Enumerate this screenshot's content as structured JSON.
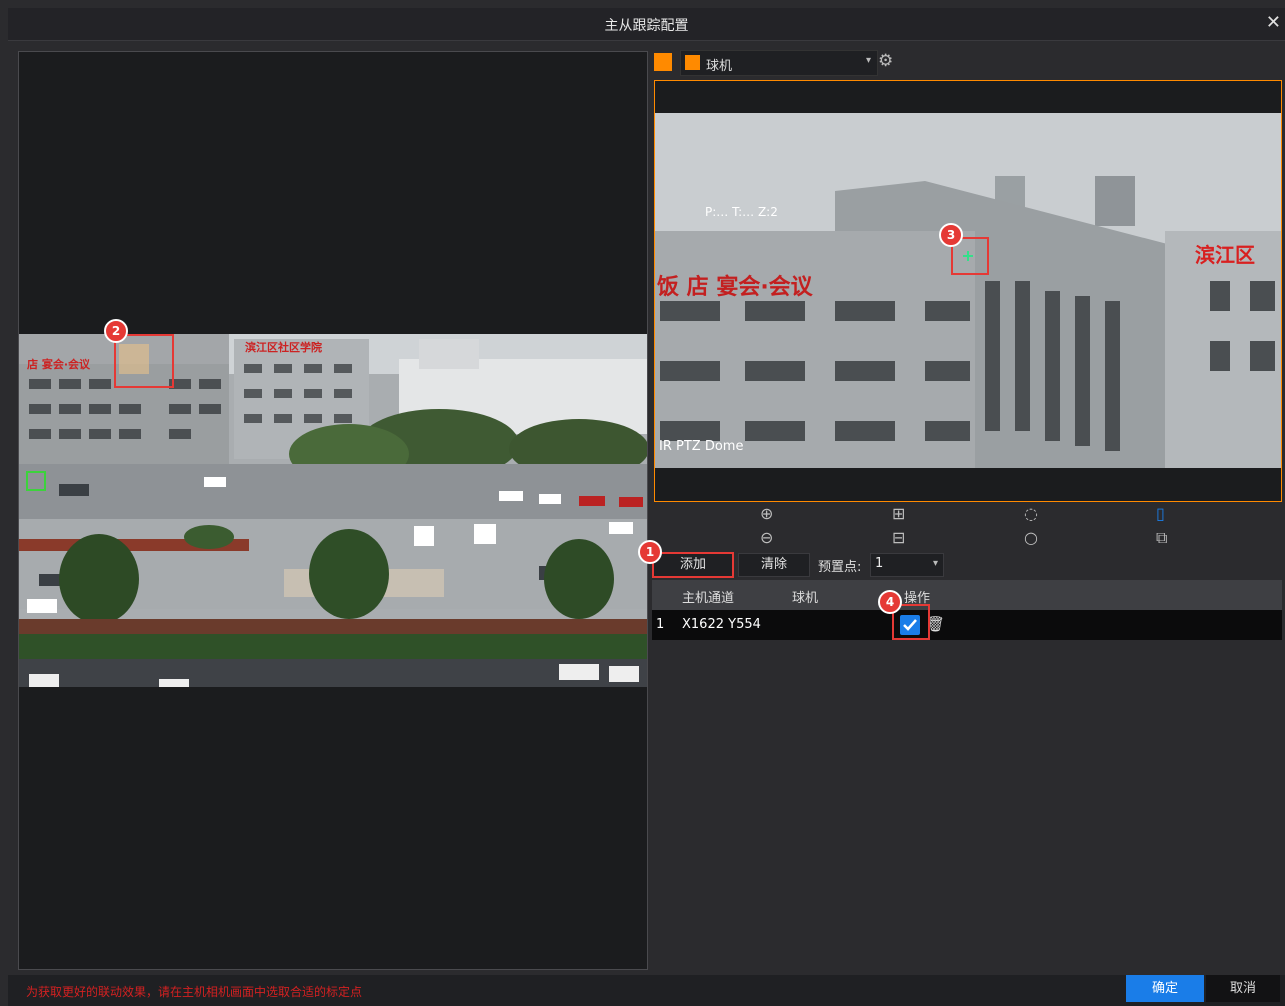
{
  "window": {
    "title": "主从跟踪配置",
    "close_icon": "close-icon"
  },
  "right_panel": {
    "device_select": {
      "selected": "球机",
      "options_icon": "chevron-down-icon"
    },
    "settings_icon": "gear-icon",
    "preview": {
      "osd_channel": "IR PTZ Dome",
      "osd_ptz": "P:… T:… Z:2",
      "osd_sign": "滨江区",
      "osd_sign2": "饭 店 宴会·会议"
    },
    "ptz_controls": [
      "zoom-in-icon",
      "focus-near-icon",
      "iris-open-icon",
      "mouse-mode-icon",
      "zoom-out-icon",
      "focus-far-icon",
      "iris-close-icon",
      "zoom-area-icon"
    ],
    "buttons": {
      "add": "添加",
      "clear": "清除",
      "preset_label": "预置点:",
      "preset_value": "1"
    },
    "table": {
      "columns": [
        "主机通道",
        "球机",
        "操作"
      ],
      "rows": [
        {
          "index": "1",
          "host_channel": "X1622 Y554",
          "dome": ""
        }
      ]
    }
  },
  "left_panel": {
    "image_sign1": "滨江区社区学院",
    "image_sign2": "店 宴会·会议"
  },
  "callouts": [
    "1",
    "2",
    "3",
    "4"
  ],
  "footer": {
    "message": "为获取更好的联动效果，请在主机相机画面中选取合适的标定点",
    "ok": "确定",
    "cancel": "取消"
  },
  "colors": {
    "accent": "#1a7de8",
    "orange": "#ff8a00",
    "callout": "#e53935"
  }
}
